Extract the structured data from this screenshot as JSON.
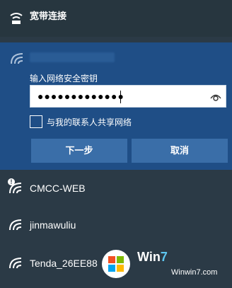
{
  "broadband": {
    "label": "宽带连接",
    "icon": "dialup-icon"
  },
  "selected_network": {
    "icon": "wifi-icon",
    "password_prompt": "输入网络安全密钥",
    "password_value": "●●●●●●●●●●●●●",
    "reveal_icon": "eye-icon",
    "share_label": "与我的联系人共享网络",
    "share_checked": false,
    "next_button": "下一步",
    "cancel_button": "取消"
  },
  "networks": [
    {
      "name": "CMCC-WEB",
      "icon": "wifi-open-icon",
      "secure": false
    },
    {
      "name": "jinmawuliu",
      "icon": "wifi-icon",
      "secure": true
    },
    {
      "name": "Tenda_26EE88",
      "icon": "wifi-icon",
      "secure": true
    }
  ],
  "watermark": {
    "brand_prefix": "Win",
    "brand_suffix": "7",
    "url": "Winwin7.com"
  }
}
